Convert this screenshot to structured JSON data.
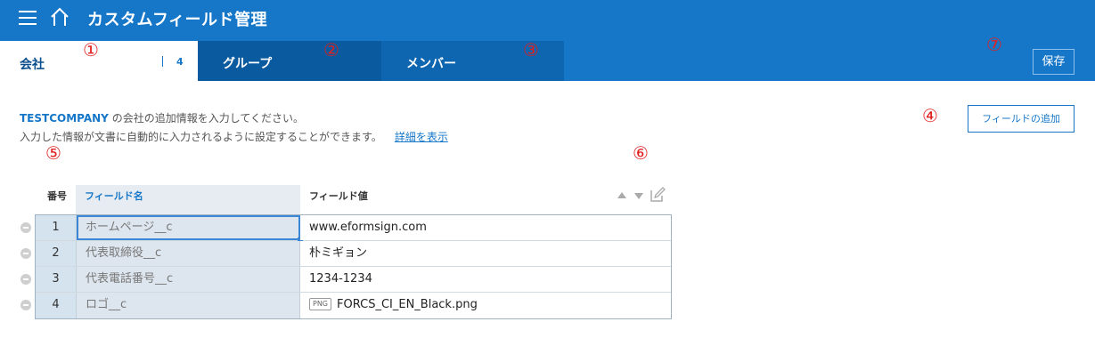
{
  "header": {
    "title": "カスタムフィールド管理",
    "menu_icon": "hamburger-menu-icon",
    "home_icon": "home-icon"
  },
  "tabs": {
    "company": {
      "label": "会社",
      "count": "4"
    },
    "group": {
      "label": "グループ"
    },
    "member": {
      "label": "メンバー"
    }
  },
  "toolbar": {
    "save_label": "保存",
    "add_field_label": "フィールドの追加"
  },
  "description": {
    "company_name": "TESTCOMPANY",
    "line1_rest": " の会社の追加情報を入力してください。",
    "line2": "入力した情報が文書に自動的に入力されるように設定することができます。",
    "details_link": "詳細を表示"
  },
  "table": {
    "headers": {
      "number": "番号",
      "field_name": "フィールド名",
      "field_value": "フィールド値"
    },
    "rows": [
      {
        "number": "1",
        "name": "ホームページ__c",
        "value": "www.eformsign.com"
      },
      {
        "number": "2",
        "name": "代表取締役__c",
        "value": "朴ミギョン"
      },
      {
        "number": "3",
        "name": "代表電話番号__c",
        "value": "1234-1234"
      },
      {
        "number": "4",
        "name": "ロゴ__c",
        "value": "FORCS_CI_EN_Black.png",
        "badge": "PNG"
      }
    ]
  },
  "markers": [
    "①",
    "②",
    "③",
    "④",
    "⑤",
    "⑥",
    "⑦"
  ],
  "colors": {
    "header_bg": "#1677c9",
    "tab_group_bg": "#0a5aa0",
    "marker": "#e02020"
  }
}
